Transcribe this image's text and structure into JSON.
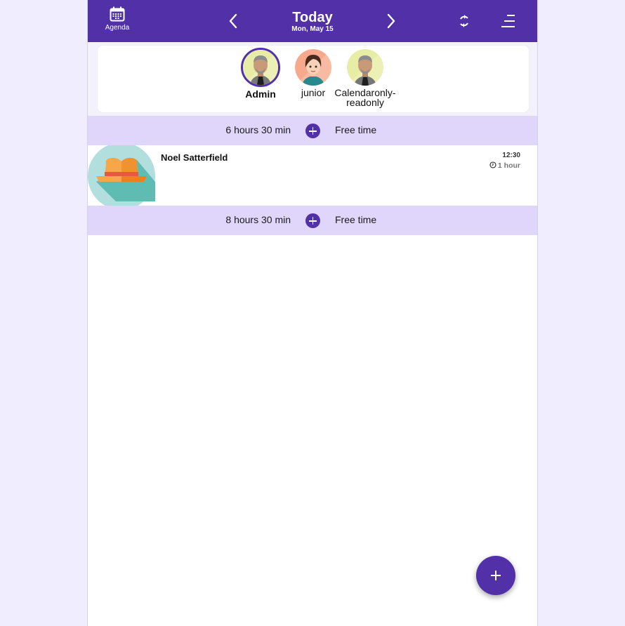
{
  "header": {
    "agenda_label": "Agenda",
    "title": "Today",
    "subtitle": "Mon, May 15",
    "icons": [
      "calendar-icon",
      "chevron-left-icon",
      "chevron-right-icon",
      "sync-icon",
      "menu-icon"
    ]
  },
  "users": [
    {
      "name": "Admin",
      "selected": true
    },
    {
      "name": "junior",
      "selected": false
    },
    {
      "name": "Calendaronly-readonly",
      "line1": "Calendaronly-",
      "line2": "readonly",
      "selected": false
    }
  ],
  "timeline": {
    "free1": {
      "duration": "6 hours 30 min",
      "label": "Free time"
    },
    "appointment": {
      "client": "Noel Satterfield",
      "time": "12:30",
      "duration": "1 hour",
      "icon": "hat-icon"
    },
    "free2": {
      "duration": "8 hours 30 min",
      "label": "Free time"
    }
  },
  "colors": {
    "brand": "#5130a8",
    "free_row": "#e0d5fb",
    "page_bg": "#f0eefe"
  }
}
